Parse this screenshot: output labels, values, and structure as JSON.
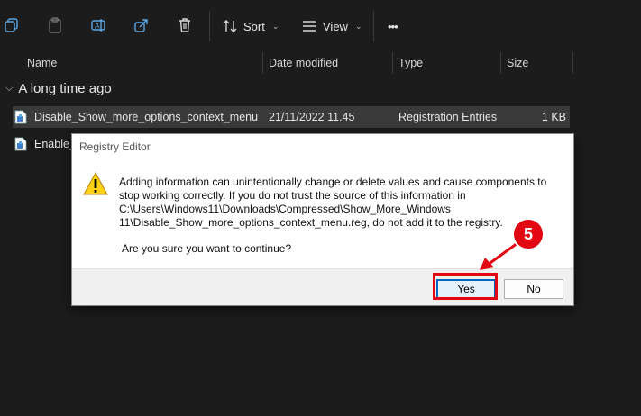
{
  "toolbar": {
    "sort_label": "Sort",
    "view_label": "View",
    "more_label": "•••"
  },
  "columns": {
    "name": "Name",
    "date": "Date modified",
    "type": "Type",
    "size": "Size"
  },
  "group": {
    "label": "A long time ago"
  },
  "files": [
    {
      "name": "Disable_Show_more_options_context_menu",
      "date": "21/11/2022 11.45",
      "type": "Registration Entries",
      "size": "1 KB"
    },
    {
      "name": "Enable_",
      "date": "",
      "type": "",
      "size": ""
    }
  ],
  "dialog": {
    "title": "Registry Editor",
    "message_lines": [
      "Adding information can unintentionally change or delete values and cause components to",
      "stop working correctly. If you do not trust the source of this information in",
      "C:\\Users\\Windows11\\Downloads\\Compressed\\Show_More_Windows",
      "11\\Disable_Show_more_options_context_menu.reg, do not add it to the registry."
    ],
    "question": "Are you sure you want to continue?",
    "yes_label": "Yes",
    "no_label": "No"
  },
  "annotation": {
    "step_number": "5",
    "color": "#e30613"
  }
}
